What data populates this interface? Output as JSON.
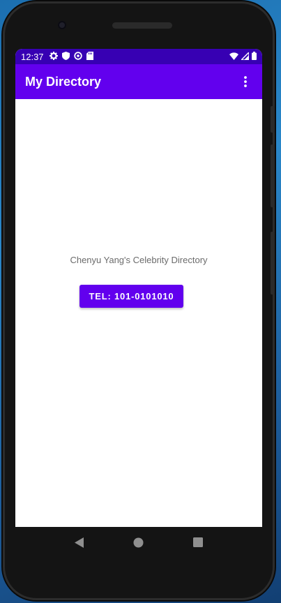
{
  "status_bar": {
    "time": "12:37",
    "left_icons": [
      "gear-icon",
      "shield-icon",
      "sync-icon",
      "sd-card-icon"
    ],
    "right_icons": [
      "wifi-icon",
      "cell-signal-icon",
      "battery-icon"
    ],
    "background": "#3700b3"
  },
  "app_bar": {
    "title": "My Directory",
    "menu_icon": "overflow-menu-icon",
    "background": "#6200ee"
  },
  "main": {
    "heading": "Chenyu Yang's Celebrity Directory",
    "tel_button_label": "TEL: 101-0101010",
    "button_color": "#6200ee"
  },
  "nav_bar": {
    "buttons": [
      "back-icon",
      "home-icon",
      "recents-icon"
    ]
  }
}
